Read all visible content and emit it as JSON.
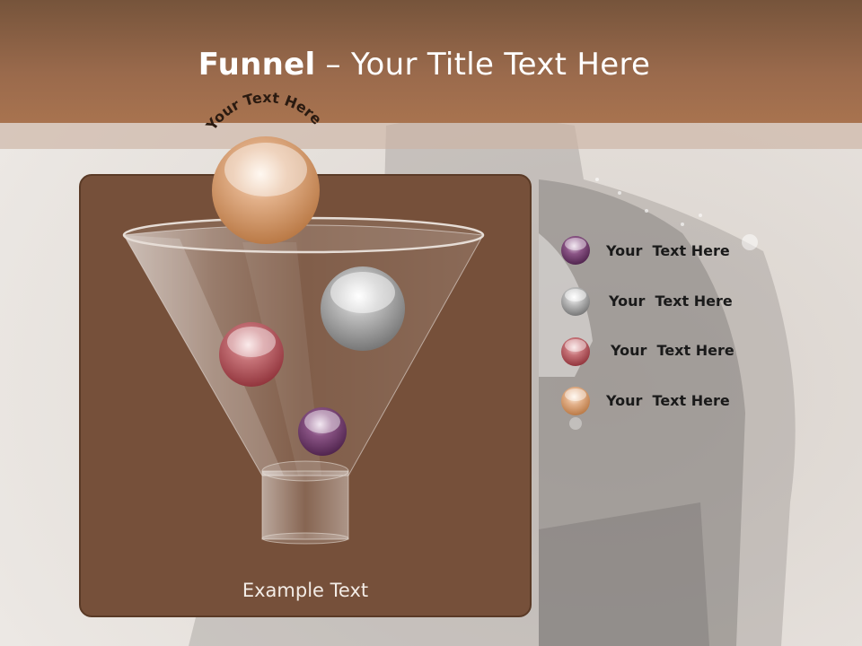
{
  "slide": {
    "title_bold": "Funnel",
    "title_rest": " – Your Title Text Here"
  },
  "funnel": {
    "top_ball_label": "Your Text Here",
    "bottom_label": "Example Text",
    "balls": [
      {
        "name": "top-ball",
        "color": "#c58a55"
      },
      {
        "name": "gray-ball",
        "color": "#8a8a8a"
      },
      {
        "name": "red-ball",
        "color": "#a5474e"
      },
      {
        "name": "purple-ball",
        "color": "#5c2a5a"
      }
    ]
  },
  "legend": {
    "items": [
      {
        "label": "Your  Text Here",
        "color": "#5c2a5a",
        "icon": "purple-sphere-icon"
      },
      {
        "label": "Your  Text Here",
        "color": "#8a8a8a",
        "icon": "gray-sphere-icon"
      },
      {
        "label": "Your  Text Here",
        "color": "#a5474e",
        "icon": "red-sphere-icon"
      },
      {
        "label": "Your  Text Here",
        "color": "#c58a55",
        "icon": "orange-sphere-icon"
      }
    ]
  },
  "colors": {
    "header": "#9a6a4c",
    "panel": "#76503a",
    "title_text": "#ffffff"
  }
}
